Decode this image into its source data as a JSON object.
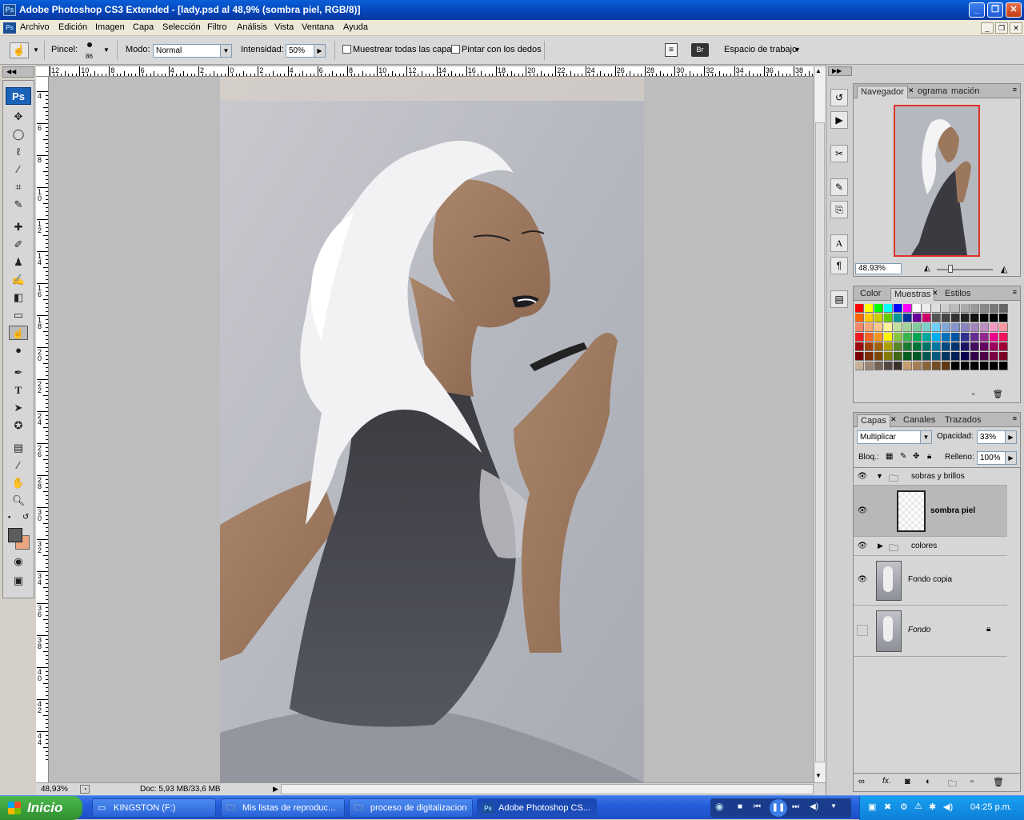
{
  "window": {
    "title": "Adobe Photoshop CS3 Extended - [lady.psd al 48,9% (sombra piel, RGB/8)]",
    "min": "_",
    "max": "❐",
    "close": "✕"
  },
  "menu": [
    "Archivo",
    "Edición",
    "Imagen",
    "Capa",
    "Selección",
    "Filtro",
    "Análisis",
    "Vista",
    "Ventana",
    "Ayuda"
  ],
  "options": {
    "brush_label": "Pincel:",
    "brush_size": "86",
    "mode_label": "Modo:",
    "mode_value": "Normal",
    "intensity_label": "Intensidad:",
    "intensity_value": "50%",
    "sample_all": "Muestrear todas las capas",
    "finger_paint": "Pintar con los dedos",
    "workspace": "Espacio de trabajo"
  },
  "ruler": {
    "top": [
      "12",
      "10",
      "8",
      "6",
      "4",
      "2",
      "0",
      "2",
      "4",
      "6",
      "8",
      "10",
      "12",
      "14",
      "16",
      "18",
      "20",
      "22",
      "24",
      "26",
      "28",
      "30",
      "32",
      "34",
      "36",
      "38"
    ],
    "left": [
      "4",
      "6",
      "8",
      "10",
      "12",
      "14",
      "16",
      "18",
      "20",
      "22",
      "24",
      "26",
      "28",
      "30",
      "32",
      "34",
      "36",
      "38",
      "40",
      "42",
      "44"
    ]
  },
  "status": {
    "zoom": "48,93%",
    "doc": "Doc: 5,93 MB/33,6 MB"
  },
  "navigator": {
    "tabs": [
      "Navegador",
      "ograma",
      "mación"
    ],
    "zoom": "48.93%"
  },
  "swatches": {
    "tabs": [
      "Color",
      "Muestras",
      "Estilos"
    ],
    "rows": [
      [
        "#ff0000",
        "#ffff00",
        "#00ff00",
        "#00ffff",
        "#0000ff",
        "#ff00ff",
        "#ffffff",
        "#eeeeee",
        "#dddddd",
        "#cccccc",
        "#bbbbbb",
        "#aaaaaa",
        "#999999",
        "#888888",
        "#777777",
        "#666666"
      ],
      [
        "#ff6600",
        "#ffcc00",
        "#cccc00",
        "#66cc00",
        "#009999",
        "#003399",
        "#660099",
        "#cc0066",
        "#555555",
        "#444444",
        "#333333",
        "#222222",
        "#111111",
        "#000000",
        "#000000",
        "#000000"
      ],
      [
        "#f4876a",
        "#f7a878",
        "#fbc788",
        "#fff199",
        "#c4df9b",
        "#a2d39c",
        "#82ca9d",
        "#7bcdc8",
        "#6ecff6",
        "#7ea7d8",
        "#8493ca",
        "#8882be",
        "#a186be",
        "#bc8dbf",
        "#f49ac2",
        "#f6989d"
      ],
      [
        "#ed1c24",
        "#f26522",
        "#f7941d",
        "#fff200",
        "#8dc63f",
        "#39b54a",
        "#00a651",
        "#00a99d",
        "#00aeef",
        "#0072bc",
        "#0054a6",
        "#2e3192",
        "#662d91",
        "#92278f",
        "#ec008c",
        "#ed145b"
      ],
      [
        "#9e0b0f",
        "#a0410d",
        "#a36209",
        "#aba000",
        "#598527",
        "#197b30",
        "#007236",
        "#00746b",
        "#0076a3",
        "#004a80",
        "#003471",
        "#1b1464",
        "#440e62",
        "#630460",
        "#9e005d",
        "#9e0039"
      ],
      [
        "#790000",
        "#7b2e00",
        "#7d4900",
        "#827b00",
        "#406618",
        "#005e20",
        "#005826",
        "#005952",
        "#005b7f",
        "#003663",
        "#002157",
        "#0d004c",
        "#32004b",
        "#4b0049",
        "#7b0046",
        "#7a0026"
      ],
      [
        "#c7b299",
        "#998675",
        "#736357",
        "#534741",
        "#37302a",
        "#c69c6d",
        "#a67c52",
        "#8c6239",
        "#754c24",
        "#603913",
        "#000000",
        "#000000",
        "#000000",
        "#000000",
        "#000000",
        "#000000"
      ]
    ]
  },
  "layers": {
    "tabs": [
      "Capas",
      "Canales",
      "Trazados"
    ],
    "blend": "Multiplicar",
    "opacity_label": "Opacidad:",
    "opacity": "33%",
    "lock_label": "Bloq.:",
    "fill_label": "Relleno:",
    "fill": "100%",
    "items": [
      {
        "name": "sobras y brillos",
        "kind": "group-open"
      },
      {
        "name": "sombra piel",
        "kind": "layer-selected"
      },
      {
        "name": "colores",
        "kind": "group-closed"
      },
      {
        "name": "Fondo copia",
        "kind": "image"
      },
      {
        "name": "Fondo",
        "kind": "image-locked"
      }
    ]
  },
  "taskbar": {
    "start": "Inicio",
    "items": [
      "KINGSTON (F:)",
      "Mis listas de reproduc...",
      "proceso de digitalizacion",
      "Adobe Photoshop CS..."
    ],
    "clock": "04:25 p.m."
  }
}
